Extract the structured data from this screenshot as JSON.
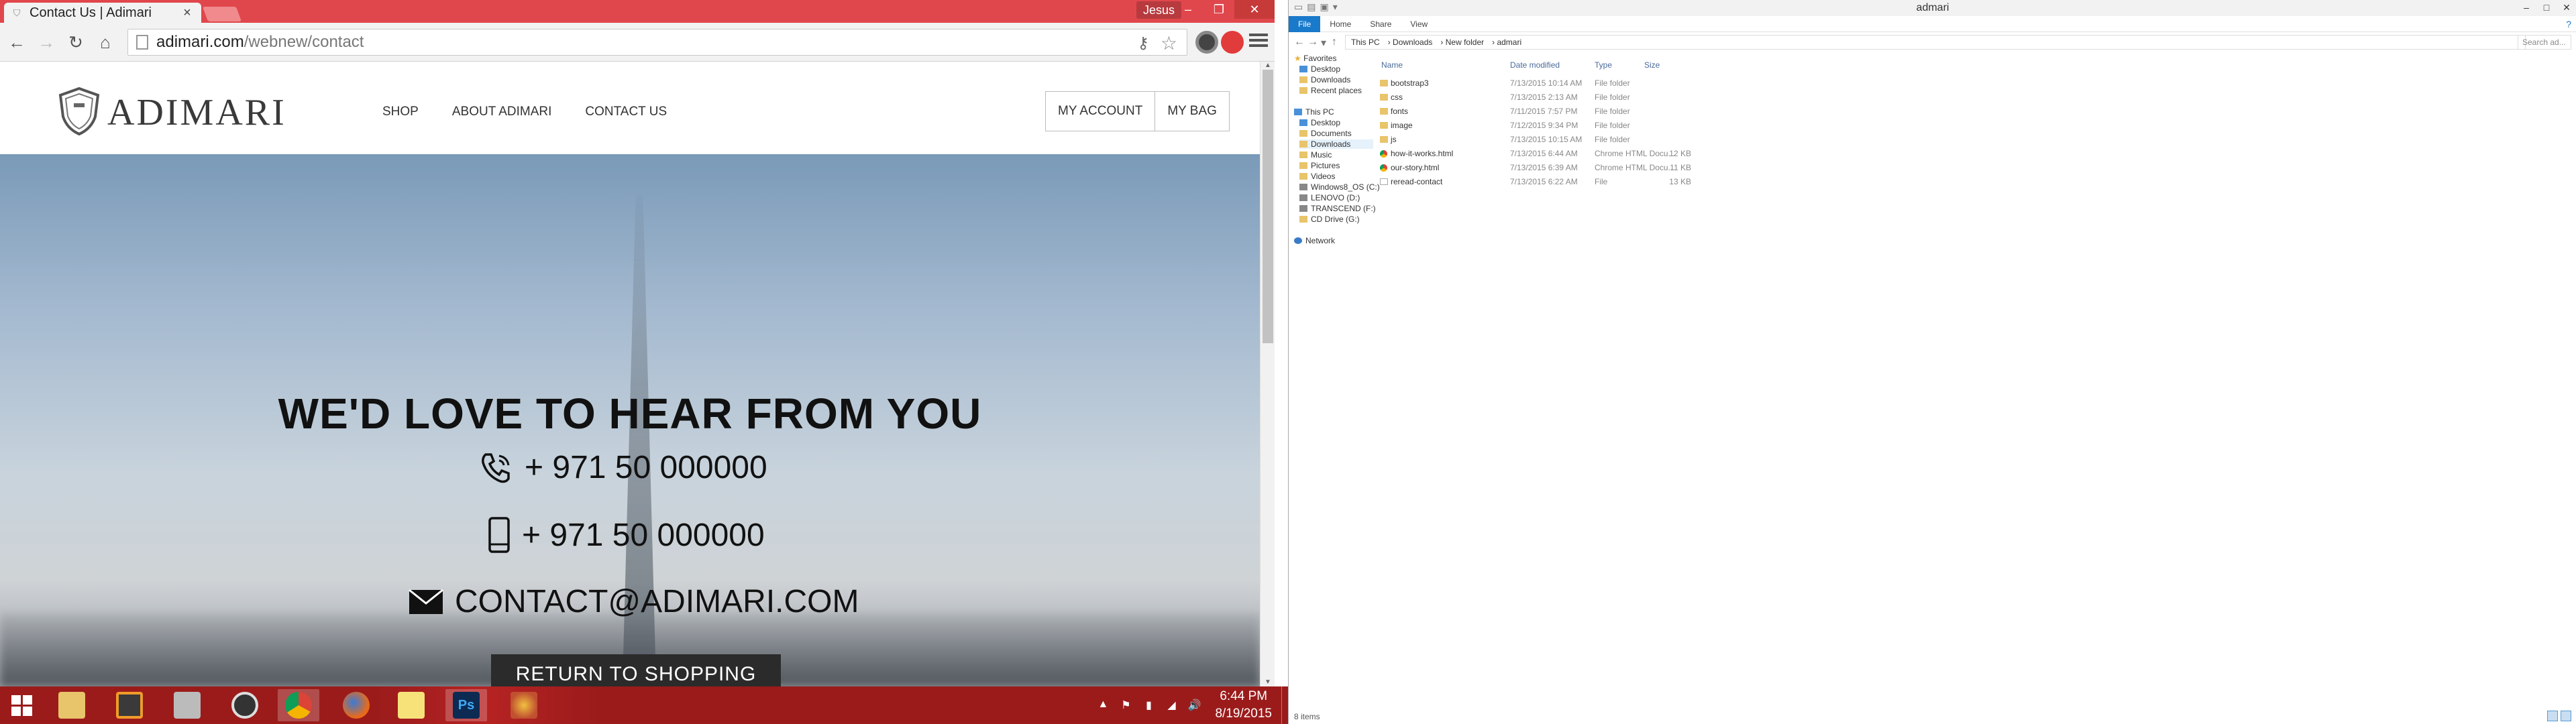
{
  "browser": {
    "tab_title": "Contact Us | Adimari",
    "user_name": "Jesus",
    "url_host": "adimari.com",
    "url_path": "/webnew/contact"
  },
  "site": {
    "logo": "ADIMARI",
    "nav": [
      "SHOP",
      "ABOUT ADIMARI",
      "CONTACT US"
    ],
    "account": "MY ACCOUNT",
    "bag": "MY BAG",
    "hero_title": "WE'D LOVE TO HEAR FROM YOU",
    "phone": "+ 971 50 000000",
    "mobile": "+ 971 50 000000",
    "email": "CONTACT@ADIMARI.COM",
    "return_button": "RETURN TO SHOPPING"
  },
  "explorer": {
    "window_title": "admari",
    "ribbon_tabs": [
      "File",
      "Home",
      "Share",
      "View"
    ],
    "breadcrumb": [
      "This PC",
      "Downloads",
      "New folder",
      "admari"
    ],
    "search_placeholder": "Search ad...",
    "nav_pane": {
      "favorites": "Favorites",
      "favorites_items": [
        "Desktop",
        "Downloads",
        "Recent places"
      ],
      "this_pc": "This PC",
      "pc_items": [
        "Desktop",
        "Documents",
        "Downloads",
        "Music",
        "Pictures",
        "Videos",
        "Windows8_OS (C:)",
        "LENOVO (D:)",
        "TRANSCEND (F:)",
        "CD Drive (G:)"
      ],
      "network": "Network"
    },
    "columns": [
      "Name",
      "Date modified",
      "Type",
      "Size"
    ],
    "files": [
      {
        "name": "bootstrap3",
        "date": "7/13/2015 10:14 AM",
        "type": "File folder",
        "size": "",
        "kind": "folder"
      },
      {
        "name": "css",
        "date": "7/13/2015 2:13 AM",
        "type": "File folder",
        "size": "",
        "kind": "folder"
      },
      {
        "name": "fonts",
        "date": "7/11/2015 7:57 PM",
        "type": "File folder",
        "size": "",
        "kind": "folder"
      },
      {
        "name": "image",
        "date": "7/12/2015 9:34 PM",
        "type": "File folder",
        "size": "",
        "kind": "folder"
      },
      {
        "name": "js",
        "date": "7/13/2015 10:15 AM",
        "type": "File folder",
        "size": "",
        "kind": "folder"
      },
      {
        "name": "how-it-works.html",
        "date": "7/13/2015 6:44 AM",
        "type": "Chrome HTML Docu...",
        "size": "12 KB",
        "kind": "chrome"
      },
      {
        "name": "our-story.html",
        "date": "7/13/2015 6:39 AM",
        "type": "Chrome HTML Docu...",
        "size": "11 KB",
        "kind": "chrome"
      },
      {
        "name": "reread-contact",
        "date": "7/13/2015 6:22 AM",
        "type": "File",
        "size": "13 KB",
        "kind": "file"
      }
    ],
    "status": "8 items"
  },
  "taskbar": {
    "time": "6:44 PM",
    "date": "8/19/2015"
  },
  "colors": {
    "chrome_titlebar": "#e0474c",
    "taskbar": "#9b1b1b",
    "explorer_accent": "#1979ca"
  }
}
